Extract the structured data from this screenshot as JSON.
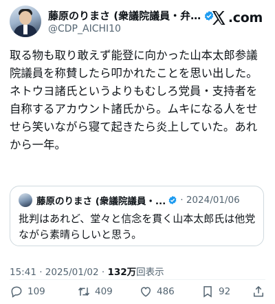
{
  "author": {
    "name": "藤原のりまさ (衆議院議員・弁…",
    "handle": "@CDP_AICHI10"
  },
  "brand": {
    "logo_text": ".com",
    "logo_icon": "x-logo"
  },
  "tweet": {
    "text": "取る物も取り敢えず能登に向かった山本太郎参議院議員を称賛したら叩かれたことを思い出した。ネトウヨ諸氏というよりもむしろ党員・支持者を自称するアカウント諸氏から。ムキになる人をせせら笑いながら寝て起きたら炎上していた。あれから一年。"
  },
  "quote": {
    "name": "藤原のりまさ (衆議院議員・...",
    "date": "· 2024/01/06",
    "text": "批判はあれど、堂々と信念を貫く山本太郎氏は他党ながら素晴らしいと思う。"
  },
  "meta": {
    "time_date": "15:41 · 2025/01/02 · ",
    "views_count": "132万",
    "views_label": "回表示"
  },
  "actions": {
    "replies": "109",
    "retweets": "409",
    "likes": "486",
    "bookmarks": "92"
  },
  "colors": {
    "verified": "#1d9bf0",
    "text": "#0f1419",
    "muted": "#536471"
  }
}
